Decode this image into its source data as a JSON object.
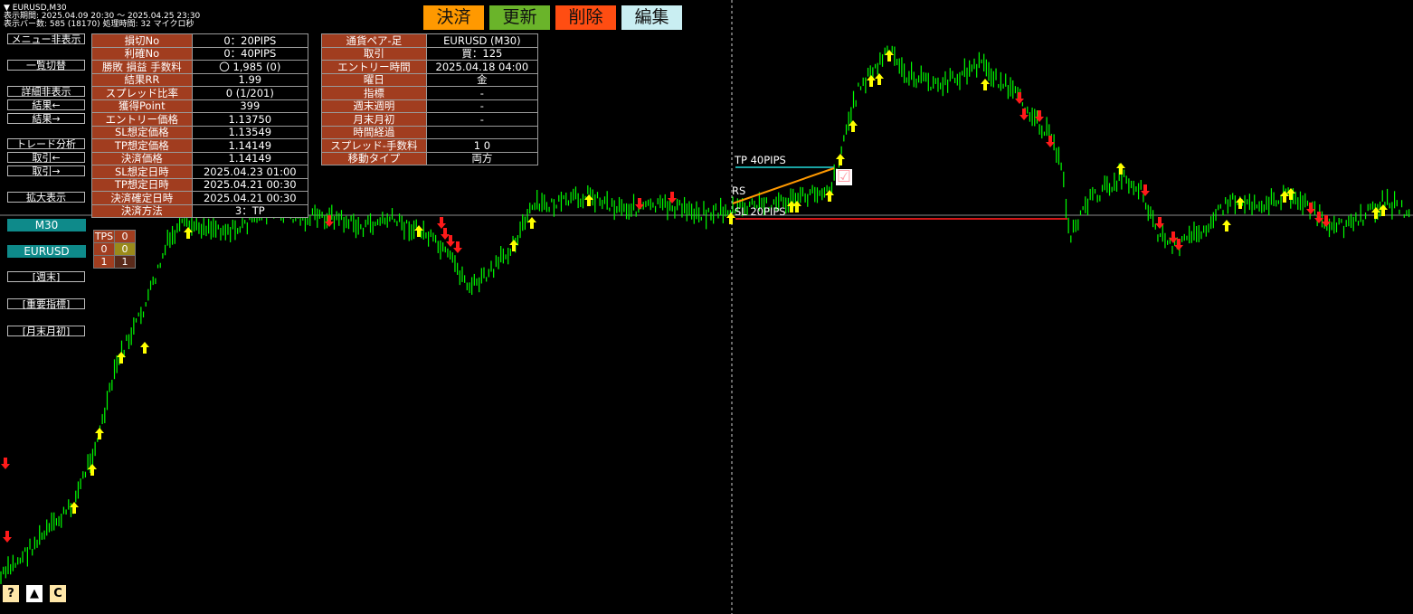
{
  "header": {
    "symbol": "▼ EURUSD,M30",
    "period": "表示期間: 2025.04.09 20:30 ～ 2025.04.25 23:30",
    "bars": "表示バー数: 585 (18170)  処理時間: 32 マイクロ秒"
  },
  "left_menu": [
    {
      "label": "メニュー非表示"
    },
    {
      "label": "一覧切替"
    },
    {
      "label": "詳細非表示"
    },
    {
      "label": "結果←"
    },
    {
      "label": "結果→"
    },
    {
      "label": "トレード分析"
    },
    {
      "label": "取引←"
    },
    {
      "label": "取引→"
    },
    {
      "label": "拡大表示"
    },
    {
      "label": "[週末]"
    },
    {
      "label": "[重要指標]"
    },
    {
      "label": "[月末月初]"
    }
  ],
  "timeframe_label": "M30",
  "symbol_label": "EURUSD",
  "info_left": [
    {
      "key": "損切No",
      "value": "0：20PIPS"
    },
    {
      "key": "利確No",
      "value": "0：40PIPS"
    },
    {
      "key": "勝敗 損益 手数料",
      "value": "〇 1,985 (0)"
    },
    {
      "key": "結果RR",
      "value": "1.99"
    },
    {
      "key": "スプレッド比率",
      "value": "0 (1/201)"
    },
    {
      "key": "獲得Point",
      "value": "399"
    },
    {
      "key": "エントリー価格",
      "value": "1.13750"
    },
    {
      "key": "SL想定価格",
      "value": "1.13549"
    },
    {
      "key": "TP想定価格",
      "value": "1.14149"
    },
    {
      "key": "決済価格",
      "value": "1.14149"
    },
    {
      "key": "SL想定日時",
      "value": "2025.04.23 01:00"
    },
    {
      "key": "TP想定日時",
      "value": "2025.04.21 00:30"
    },
    {
      "key": "決済確定日時",
      "value": "2025.04.21 00:30"
    },
    {
      "key": "決済方法",
      "value": "3：TP"
    }
  ],
  "info_right": [
    {
      "key": "通貨ペア-足",
      "value": "EURUSD (M30)"
    },
    {
      "key": "取引",
      "value": "買：125"
    },
    {
      "key": "エントリー時間",
      "value": "2025.04.18 04:00"
    },
    {
      "key": "曜日",
      "value": "金"
    },
    {
      "key": "指標",
      "value": "-"
    },
    {
      "key": "週末週明",
      "value": "-"
    },
    {
      "key": "月末月初",
      "value": "-"
    },
    {
      "key": "時間経過",
      "value": ""
    },
    {
      "key": "スプレッド-手数料",
      "value": "1  0"
    },
    {
      "key": "移動タイプ",
      "value": "両方"
    }
  ],
  "top_buttons": [
    {
      "label": "決済",
      "color": "#ff9900"
    },
    {
      "label": "更新",
      "color": "#6ab42a"
    },
    {
      "label": "削除",
      "color": "#ff4d12"
    },
    {
      "label": "編集",
      "color": "#c9eef2"
    }
  ],
  "tps_table": {
    "header": "TPS",
    "h_val": "0",
    "r1": [
      "0",
      "0"
    ],
    "r2": [
      "1",
      "1"
    ]
  },
  "labels": {
    "tp": "TP  40PIPS",
    "sl": "SL  20PIPS",
    "rs": "RS",
    "check": "☑"
  },
  "bottom_buttons": [
    "?",
    "▲",
    "C"
  ],
  "colors": {
    "bull": "#00ff00",
    "arrow_up": "#ffff00",
    "arrow_down": "#ff1a1a",
    "table_key": "#a13d1f",
    "teal": "#0e8a8a"
  }
}
